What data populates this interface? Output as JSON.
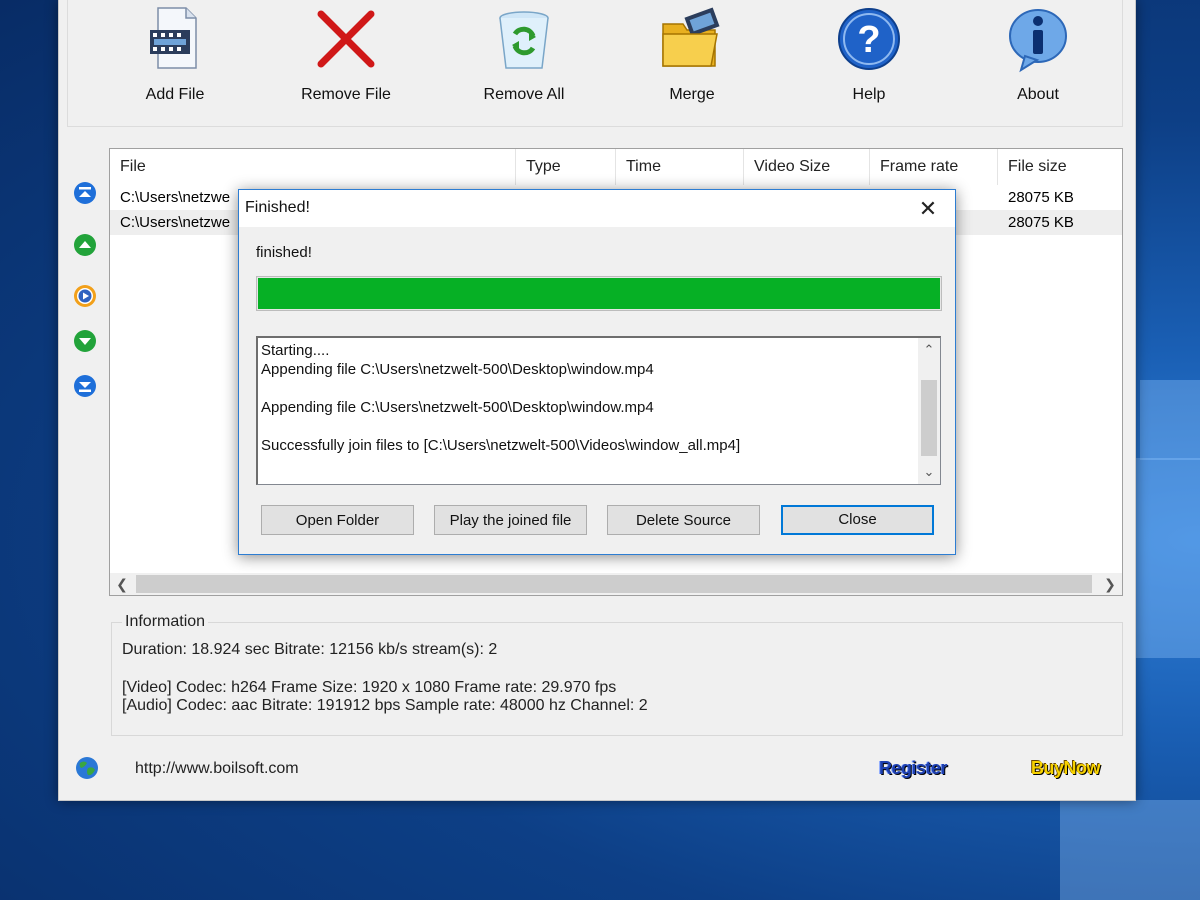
{
  "toolbar": {
    "items": [
      {
        "label": "Add File",
        "icon": "film-file-icon"
      },
      {
        "label": "Remove File",
        "icon": "red-x-icon"
      },
      {
        "label": "Remove All",
        "icon": "recycle-bin-icon"
      },
      {
        "label": "Merge",
        "icon": "folder-film-icon"
      },
      {
        "label": "Help",
        "icon": "help-question-icon"
      },
      {
        "label": "About",
        "icon": "info-icon"
      }
    ]
  },
  "file_list": {
    "columns": [
      "File",
      "Type",
      "Time",
      "Video Size",
      "Frame rate",
      "File size"
    ],
    "rows": [
      {
        "file": "C:\\Users\\netzwe",
        "file_size": "28075 KB"
      },
      {
        "file": "C:\\Users\\netzwe",
        "file_size": "28075 KB"
      }
    ]
  },
  "information": {
    "title": "Information",
    "line1": "Duration: 18.924 sec  Bitrate: 12156 kb/s  stream(s): 2",
    "line2": "[Video]  Codec: h264  Frame Size: 1920 x 1080  Frame rate: 29.970 fps",
    "line3": "[Audio]  Codec: aac  Bitrate: 191912 bps  Sample rate: 48000 hz  Channel: 2"
  },
  "footer": {
    "url": "http://www.boilsoft.com",
    "register_label": "Register",
    "buynow_label": "BuyNow"
  },
  "dialog": {
    "title": "Finished!",
    "close_glyph": "✕",
    "status": "finished!",
    "progress_fraction": 1.0,
    "progress_color": "#06b025",
    "log": "Starting....\nAppending file C:\\Users\\netzwelt-500\\Desktop\\window.mp4\n\nAppending file C:\\Users\\netzwelt-500\\Desktop\\window.mp4\n\nSuccessfully join files to [C:\\Users\\netzwelt-500\\Videos\\window_all.mp4]",
    "buttons": {
      "open_folder": "Open Folder",
      "play": "Play the joined file",
      "delete_source": "Delete Source",
      "close": "Close"
    }
  },
  "colors": {
    "accent": "#0078d7",
    "progress": "#06b025"
  }
}
